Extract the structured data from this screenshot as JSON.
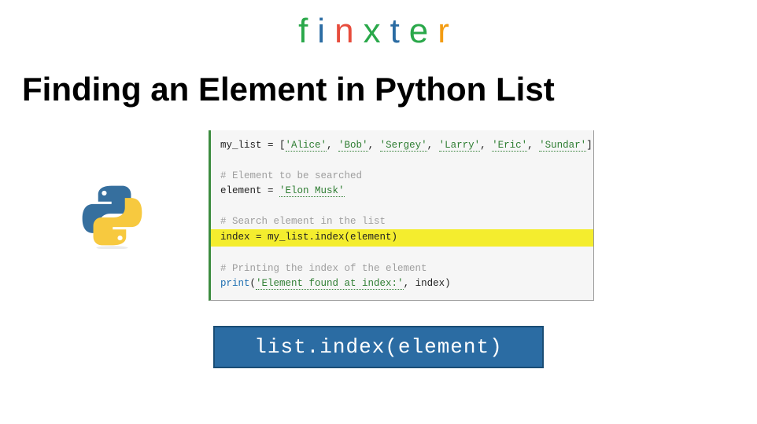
{
  "logo": {
    "letters": [
      {
        "char": "f",
        "color": "#2aa84a"
      },
      {
        "char": "i",
        "color": "#2b6ca3"
      },
      {
        "char": "n",
        "color": "#e74c3c"
      },
      {
        "char": "x",
        "color": "#2aa84a"
      },
      {
        "char": "t",
        "color": "#2b6ca3"
      },
      {
        "char": "e",
        "color": "#2aa84a"
      },
      {
        "char": "r",
        "color": "#f39c12"
      }
    ]
  },
  "title": "Finding an Element in Python List",
  "code": {
    "line1": {
      "pre": "my_list = [",
      "s1": "'Alice'",
      "c1": ", ",
      "s2": "'Bob'",
      "c2": ", ",
      "s3": "'Sergey'",
      "c3": ", ",
      "s4": "'Larry'",
      "c4": ", ",
      "s5": "'Eric'",
      "c5": ", ",
      "s6": "'Sundar'",
      "post": "]"
    },
    "comment1": "# Element to be searched",
    "line2": {
      "pre": "element = ",
      "val": "'Elon Musk'"
    },
    "comment2": "# Search element in the list",
    "line3": "index = my_list.index(element)",
    "comment3": "# Printing the index of the element",
    "line4": {
      "fn": "print",
      "open": "(",
      "str": "'Element found at index:'",
      "rest": ", index)"
    }
  },
  "method_signature": "list.index(element)"
}
